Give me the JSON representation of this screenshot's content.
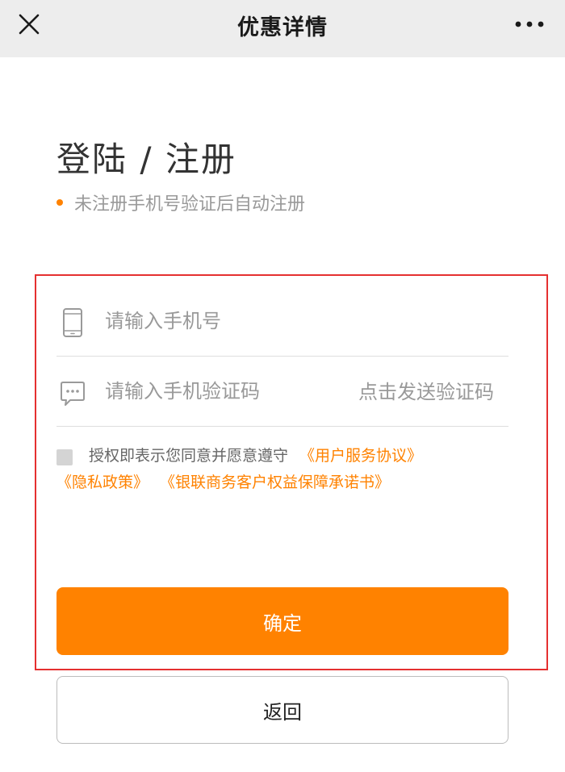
{
  "header": {
    "title": "优惠详情",
    "close_icon": "close-icon",
    "more_icon": "more-options-icon"
  },
  "login": {
    "heading": "登陆 / 注册",
    "notice": "未注册手机号验证后自动注册"
  },
  "form": {
    "phone": {
      "placeholder": "请输入手机号",
      "value": "",
      "icon": "phone-icon"
    },
    "code": {
      "placeholder": "请输入手机验证码",
      "value": "",
      "icon": "chat-bubble-icon",
      "send_label": "点击发送验证码"
    },
    "agreement": {
      "checked": false,
      "prefix": "授权即表示您同意并愿意遵守",
      "links": [
        "《用户服务协议》",
        "《隐私政策》",
        "《银联商务客户权益保障承诺书》"
      ]
    },
    "confirm_label": "确定",
    "back_label": "返回"
  },
  "colors": {
    "accent": "#ff8200",
    "header_bg": "#ededed",
    "placeholder_text": "#999999",
    "highlight_frame": "#e53030"
  }
}
